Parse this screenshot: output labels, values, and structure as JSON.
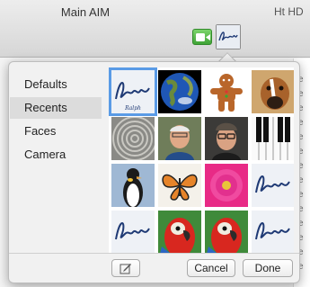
{
  "window": {
    "title": "Main AIM",
    "background_tab_text": "Ht HD"
  },
  "toolbar": {
    "facetime_icon": "video-camera-icon",
    "avatar_icon": "ralph-signature-icon"
  },
  "sidebar": {
    "items": [
      {
        "label": "Defaults",
        "selected": false
      },
      {
        "label": "Recents",
        "selected": true
      },
      {
        "label": "Faces",
        "selected": false
      },
      {
        "label": "Camera",
        "selected": false
      }
    ]
  },
  "grid": {
    "tiles": [
      {
        "name": "ralph-signature",
        "selected": true
      },
      {
        "name": "earth"
      },
      {
        "name": "gingerbread-man"
      },
      {
        "name": "boxer-puppy"
      },
      {
        "name": "zen-sand-spiral"
      },
      {
        "name": "man-portrait-1"
      },
      {
        "name": "man-portrait-2"
      },
      {
        "name": "piano-keys"
      },
      {
        "name": "penguin"
      },
      {
        "name": "butterfly"
      },
      {
        "name": "pink-flower"
      },
      {
        "name": "ralph-signature"
      },
      {
        "name": "ralph-signature"
      },
      {
        "name": "parrot"
      },
      {
        "name": "parrot"
      },
      {
        "name": "ralph-signature"
      }
    ],
    "signature_text": "Ralph"
  },
  "footer": {
    "edit_icon": "pencil-edit-icon",
    "cancel_label": "Cancel",
    "done_label": "Done"
  },
  "right_strip_letters": [
    "e",
    "e",
    "e",
    "e",
    "e",
    "e",
    "e",
    "e",
    "e",
    "e",
    "e",
    "e",
    "e",
    "e"
  ],
  "colors": {
    "selection": "#5a9be6",
    "facetime_green": "#3fa336"
  }
}
